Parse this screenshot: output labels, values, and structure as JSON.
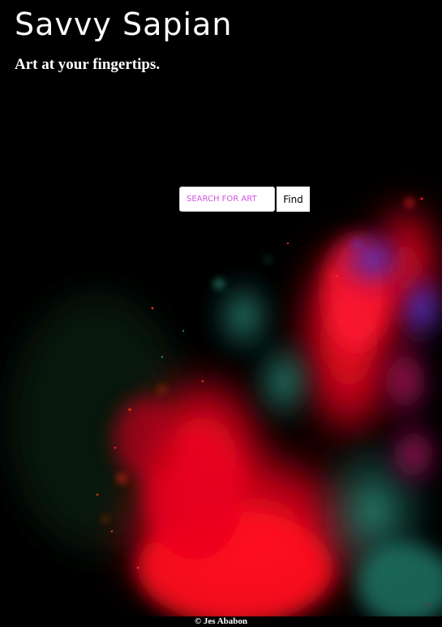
{
  "header": {
    "title": "Savvy Sapian",
    "tagline": "Art at your fingertips."
  },
  "search": {
    "placeholder": "SEARCH FOR ART",
    "value": "",
    "button_label": "Find"
  },
  "footer": {
    "credit": "© Jes Ababon"
  },
  "colors": {
    "background": "#000000",
    "text": "#ffffff",
    "placeholder": "#d255e0",
    "splash_red": "#ff0a1e",
    "splash_teal": "#1f7a6a",
    "splash_blue": "#3a3ad0",
    "splash_magenta": "#b0207a"
  },
  "hero_image": {
    "subject": "colored powder explosion"
  }
}
